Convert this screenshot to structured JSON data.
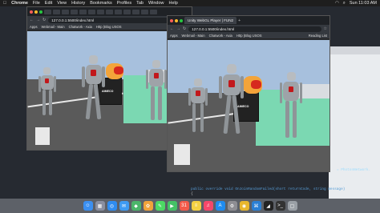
{
  "menubar": {
    "app": "Chrome",
    "items": [
      "File",
      "Edit",
      "View",
      "History",
      "Bookmarks",
      "Profiles",
      "Tab",
      "Window",
      "Help"
    ],
    "time": "Sun 11:03 AM"
  },
  "window_back": {
    "url": "127.0.0.1:5500/index.html",
    "bookmarks": [
      "Apps",
      "Webmail - Main",
      "Chatwork - Axia",
      "Http (Blog USOS",
      "Reading List"
    ]
  },
  "window_front": {
    "tab_title": "Unity WebGL Player | FUN2",
    "url": "127.0.0.1:5500/index.html",
    "bookmarks": [
      "Apps",
      "Webmail - Main",
      "Chatwork - Axia",
      "Http (Blog USOS",
      "Reading List"
    ]
  },
  "sign": {
    "text": "AIMECO"
  },
  "ide": {
    "code_line_1": "public override void OnJoinRandomFailed(short returnCode, string message)",
    "code_line_2": "{",
    "code_right": "= PhotonNetwork.",
    "warning": "NET Core SDK cannot be located. .NET Core"
  },
  "dock": {
    "icons": [
      "finder-icon",
      "launchpad-icon",
      "safari-icon",
      "mail-icon",
      "maps-icon",
      "photos-icon",
      "messages-icon",
      "facetime-icon",
      "calendar-icon",
      "notes-icon",
      "music-icon",
      "appstore-icon",
      "settings-icon",
      "chrome-icon",
      "vscode-icon",
      "unity-icon",
      "terminal-icon",
      "trash-icon"
    ],
    "colors": [
      "#3b8ff0",
      "#8a8fa0",
      "#2f8cf0",
      "#3e9bf2",
      "#4bb66a",
      "#f2a33a",
      "#4cd964",
      "#44c266",
      "#f25a4a",
      "#f5d142",
      "#f5476a",
      "#1f8cf0",
      "#8e8e93",
      "#e8b62c",
      "#2a7fd4",
      "#222222",
      "#333333",
      "#9aa0a6"
    ],
    "glyphs": [
      "☺",
      "▦",
      "◎",
      "✉",
      "◆",
      "✿",
      "✎",
      "▶",
      "31",
      "≡",
      "♫",
      "A",
      "⚙",
      "◉",
      "⌘",
      "◢",
      ">_",
      "▢"
    ]
  }
}
